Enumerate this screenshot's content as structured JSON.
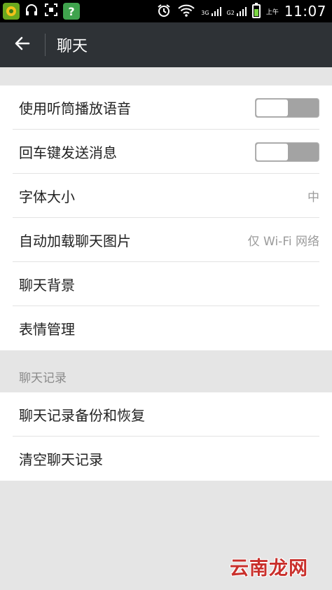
{
  "status_bar": {
    "time": "11:07",
    "network_3g": "3G",
    "network_g2": "G2",
    "am_pm": "上午",
    "notification_icons": [
      "app-notification-icon",
      "headphones-icon",
      "screenshot-icon",
      "help-app-icon"
    ],
    "status_icons": [
      "alarm-icon",
      "wifi-icon",
      "signal-icon",
      "battery-icon"
    ]
  },
  "action_bar": {
    "title": "聊天",
    "back_icon": "arrow-left-icon"
  },
  "settings": {
    "items": [
      {
        "label": "使用听筒播放语音",
        "toggle": "off"
      },
      {
        "label": "回车键发送消息",
        "toggle": "off"
      },
      {
        "label": "字体大小",
        "value": "中"
      },
      {
        "label": "自动加载聊天图片",
        "value": "仅 Wi-Fi 网络"
      },
      {
        "label": "聊天背景"
      },
      {
        "label": "表情管理"
      }
    ]
  },
  "history": {
    "header": "聊天记录",
    "items": [
      {
        "label": "聊天记录备份和恢复"
      },
      {
        "label": "清空聊天记录"
      }
    ]
  },
  "watermark": "云南龙网",
  "colors": {
    "action_bar": "#2e3236",
    "background": "#e5e5e5",
    "toggle_track": "#a3a3a3",
    "battery_fill": "#7cd644",
    "watermark": "#c9302c"
  }
}
